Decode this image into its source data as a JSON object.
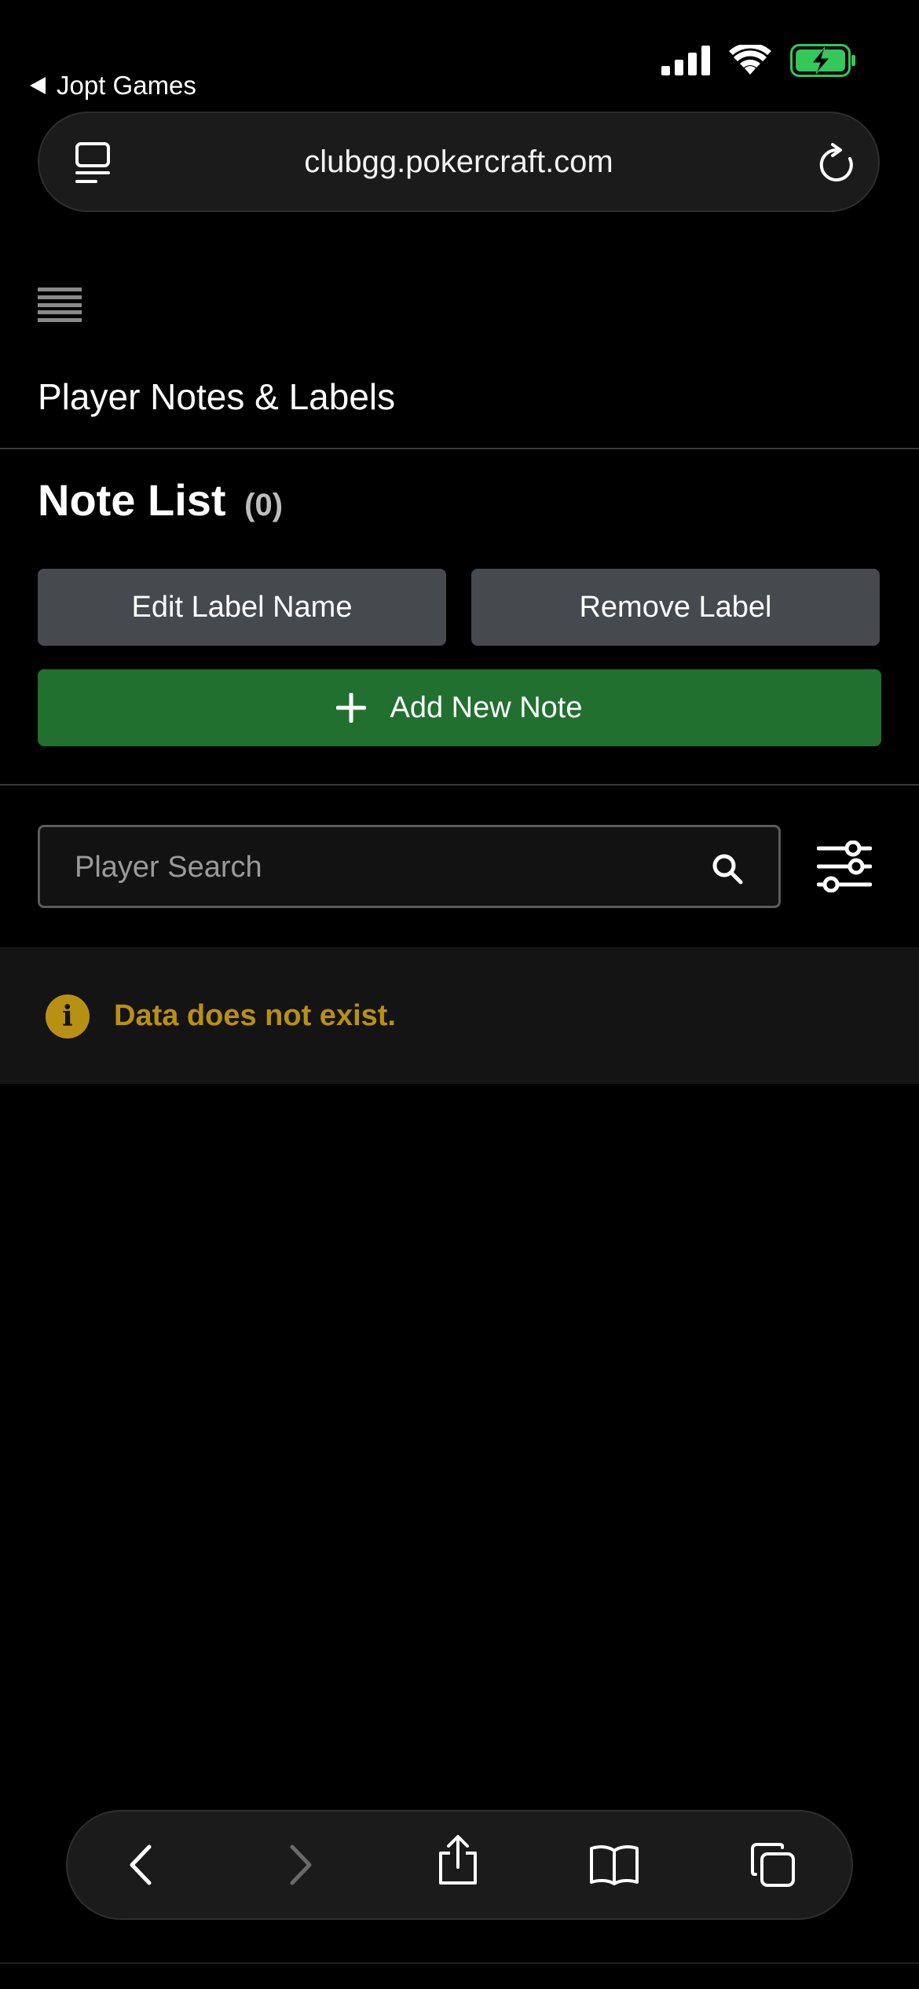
{
  "status_bar": {
    "back_app_label": "Jopt Games",
    "icons": [
      "cellular-signal-icon",
      "wifi-icon",
      "battery-charging-icon"
    ],
    "battery_color": "#34c759"
  },
  "browser": {
    "url": "clubgg.pokercraft.com"
  },
  "page": {
    "title": "Player Notes & Labels",
    "section_title": "Note List",
    "section_count": "(0)"
  },
  "actions": {
    "edit_label": "Edit Label Name",
    "remove_label": "Remove Label",
    "add_note": "Add New Note"
  },
  "search": {
    "placeholder": "Player Search",
    "value": ""
  },
  "info": {
    "message": "Data does not exist.",
    "icon_glyph": "i",
    "color": "#b89014"
  },
  "colors": {
    "add_button": "#21702f",
    "grey_button": "#464a4e"
  }
}
